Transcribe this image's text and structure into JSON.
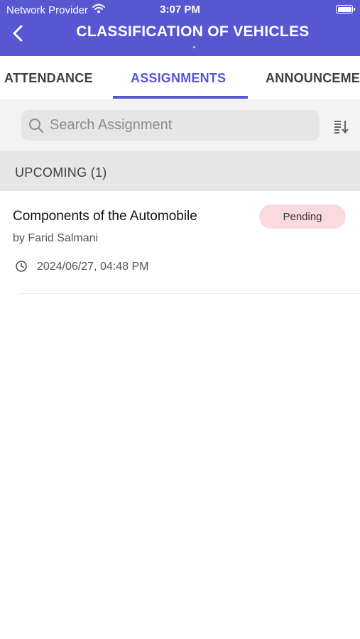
{
  "status_bar": {
    "carrier": "Network Provider",
    "time": "3:07 PM"
  },
  "header": {
    "title": "CLASSIFICATION OF VEHICLES",
    "bg_color": "#5757d1"
  },
  "tabs": [
    {
      "label": "ATTENDANCE",
      "active": false
    },
    {
      "label": "ASSIGNMENTS",
      "active": true
    },
    {
      "label": "ANNOUNCEMENTS",
      "active": false
    }
  ],
  "search": {
    "placeholder": "Search Assignment",
    "value": ""
  },
  "section": {
    "label": "UPCOMING (1)"
  },
  "assignments": [
    {
      "title": "Components of the Automobile",
      "author": "by Farid Salmani",
      "datetime": "2024/06/27, 04:48 PM",
      "status": "Pending",
      "status_color": "#fadadf"
    }
  ],
  "icons": {
    "back": "chevron-left-icon",
    "search": "search-icon",
    "sort": "sort-icon",
    "clock": "clock-icon",
    "wifi": "wifi-icon",
    "battery": "battery-icon"
  }
}
